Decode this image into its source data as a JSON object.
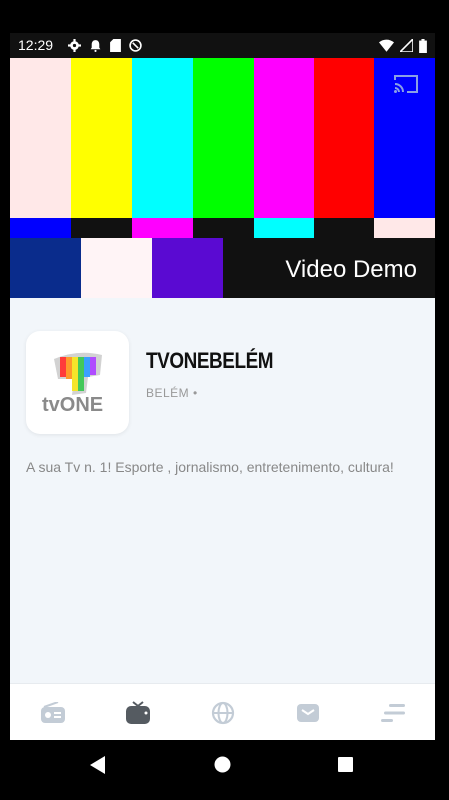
{
  "status_bar": {
    "time": "12:29",
    "left_icons": [
      "gear-icon",
      "bell-icon",
      "sd-card-icon",
      "data-saver-icon"
    ],
    "right_icons": [
      "wifi-icon",
      "signal-icon",
      "battery-icon"
    ]
  },
  "player": {
    "title": "Video Demo",
    "cast_icon": "cast-icon",
    "color_bars": [
      "#ffe8e8",
      "#ffff00",
      "#00ffff",
      "#00ff00",
      "#ff00ff",
      "#ff0000",
      "#0000ff"
    ]
  },
  "station": {
    "name": "TVONEBELÉM",
    "meta": "BELÉM •",
    "description": "A sua Tv n. 1! Esporte , jornalismo, entretenimento, cultura!",
    "logo_text": "tvONE"
  },
  "bottom_nav": {
    "items": [
      {
        "icon": "radio-icon",
        "active": false
      },
      {
        "icon": "tv-icon",
        "active": true
      },
      {
        "icon": "globe-icon",
        "active": false
      },
      {
        "icon": "mail-icon",
        "active": false
      },
      {
        "icon": "menu-icon",
        "active": false
      }
    ],
    "active_color": "#555b61",
    "inactive_color": "#c3ccd6"
  },
  "system_nav": [
    "back-icon",
    "home-icon",
    "recents-icon"
  ]
}
